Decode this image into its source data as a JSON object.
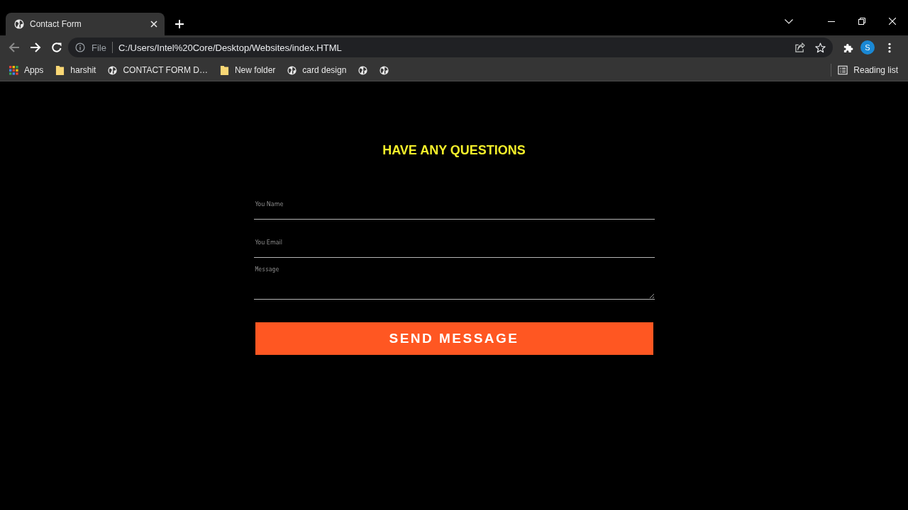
{
  "browser": {
    "tabs": [
      {
        "title": "Contact Form",
        "selected": true
      }
    ],
    "nav": [
      {
        "kind": "back",
        "disabled": true
      },
      {
        "kind": "forward",
        "disabled": false
      },
      {
        "kind": "reload",
        "disabled": false
      }
    ],
    "address_bar": {
      "scheme_label": "File",
      "url": "C:/Users/Intel%20Core/Desktop/Websites/index.HTML"
    },
    "profile_initial": "S",
    "bookmarks": [
      {
        "kind": "apps",
        "label": "Apps"
      },
      {
        "kind": "folder",
        "label": "harshit"
      },
      {
        "kind": "page",
        "label": "CONTACT FORM D…"
      },
      {
        "kind": "folder",
        "label": "New folder"
      },
      {
        "kind": "page",
        "label": "card design"
      },
      {
        "kind": "page"
      },
      {
        "kind": "page"
      }
    ],
    "reading_list": "Reading list"
  },
  "page": {
    "heading": "HAVE ANY QUESTIONS",
    "fields": [
      {
        "kind": "input",
        "placeholder": "You Name"
      },
      {
        "kind": "input",
        "placeholder": "You Email"
      },
      {
        "kind": "textarea",
        "placeholder": "Message"
      }
    ],
    "submit_button": "SEND MESSAGE"
  }
}
